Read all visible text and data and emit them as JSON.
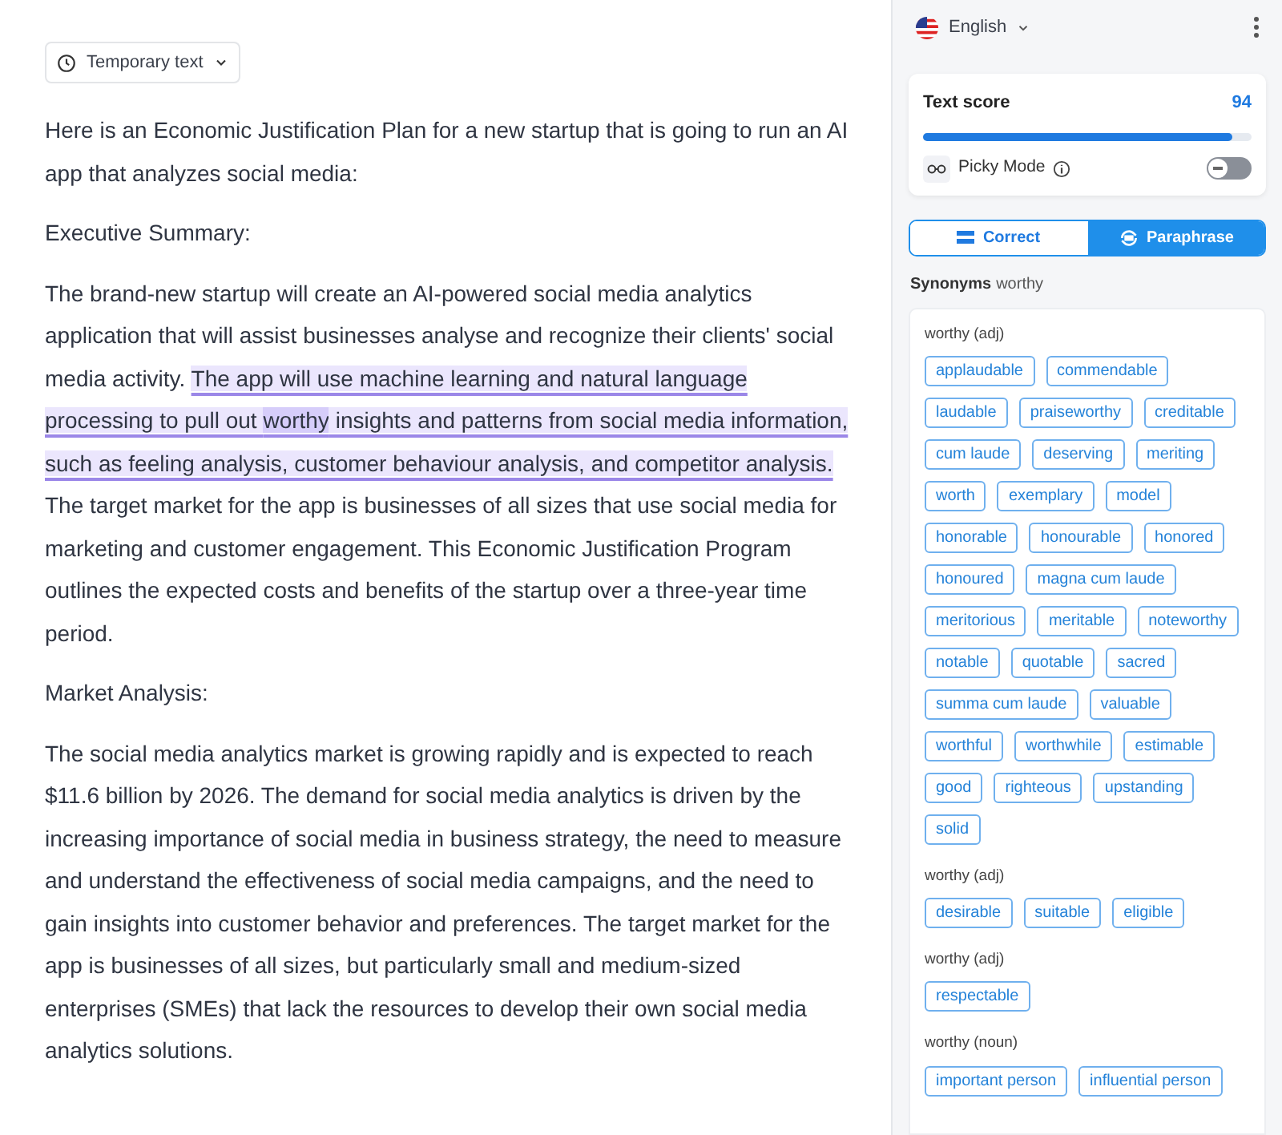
{
  "document_mode": {
    "label": "Temporary text"
  },
  "paragraphs": [
    {
      "segments": [
        {
          "kind": "plain",
          "text": "Here is an Economic Justification Plan for a new startup that is going to run an AI app that analyzes social media:"
        }
      ]
    },
    {
      "segments": [
        {
          "kind": "plain",
          "text": "Executive Summary:"
        }
      ]
    },
    {
      "segments": [
        {
          "kind": "plain",
          "text": "The brand-new startup will create an AI-powered social media analytics application that will assist businesses analyse and recognize their clients' social media activity. "
        },
        {
          "kind": "highlight",
          "text": "The app will use machine learning and natural language processing to pull out "
        },
        {
          "kind": "word",
          "text": "worthy"
        },
        {
          "kind": "highlight",
          "text": " insights and patterns from social media information, such as feeling analysis, customer behaviour analysis, and competitor analysis."
        },
        {
          "kind": "plain",
          "text": " The target market for the app is businesses of all sizes that use social media for marketing and customer engagement. This Economic Justification Program outlines the expected costs and benefits of the startup over a three-year time period."
        }
      ]
    },
    {
      "segments": [
        {
          "kind": "plain",
          "text": "Market Analysis:"
        }
      ]
    },
    {
      "segments": [
        {
          "kind": "plain",
          "text": "The social media analytics market is growing rapidly and is expected to reach $11.6 billion by 2026. The demand for social media analytics is driven by the increasing importance of social media in business strategy, the need to measure and understand the effectiveness of social media campaigns, and the need to gain insights into customer behavior and preferences. The target market for the app is businesses of all sizes, but particularly small and medium-sized enterprises (SMEs) that lack the resources to develop their own social media analytics solutions."
        }
      ]
    }
  ],
  "sidebar": {
    "language": "English",
    "score": {
      "label": "Text score",
      "value": "94",
      "level": 0.94
    },
    "picky_mode": {
      "label": "Picky Mode",
      "on": false
    },
    "tabs": [
      {
        "label": "Correct",
        "selected": false
      },
      {
        "label": "Paraphrase",
        "selected": true
      }
    ],
    "synonyms_title": "Synonyms",
    "synonyms_word": "worthy",
    "groups": [
      {
        "heading": "worthy (adj)",
        "words": [
          "applaudable",
          "commendable",
          "laudable",
          "praiseworthy",
          "creditable",
          "cum laude",
          "deserving",
          "meriting",
          "worth",
          "exemplary",
          "model",
          "honorable",
          "honourable",
          "honored",
          "honoured",
          "magna cum laude",
          "meritorious",
          "meritable",
          "noteworthy",
          "notable",
          "quotable",
          "sacred",
          "summa cum laude",
          "valuable",
          "worthful",
          "worthwhile",
          "estimable",
          "good",
          "righteous",
          "upstanding",
          "solid"
        ]
      },
      {
        "heading": "worthy (adj)",
        "words": [
          "desirable",
          "suitable",
          "eligible"
        ]
      },
      {
        "heading": "worthy (adj)",
        "words": [
          "respectable"
        ]
      },
      {
        "heading": "worthy (noun)",
        "words": [
          "important person",
          "influential person"
        ]
      }
    ]
  }
}
